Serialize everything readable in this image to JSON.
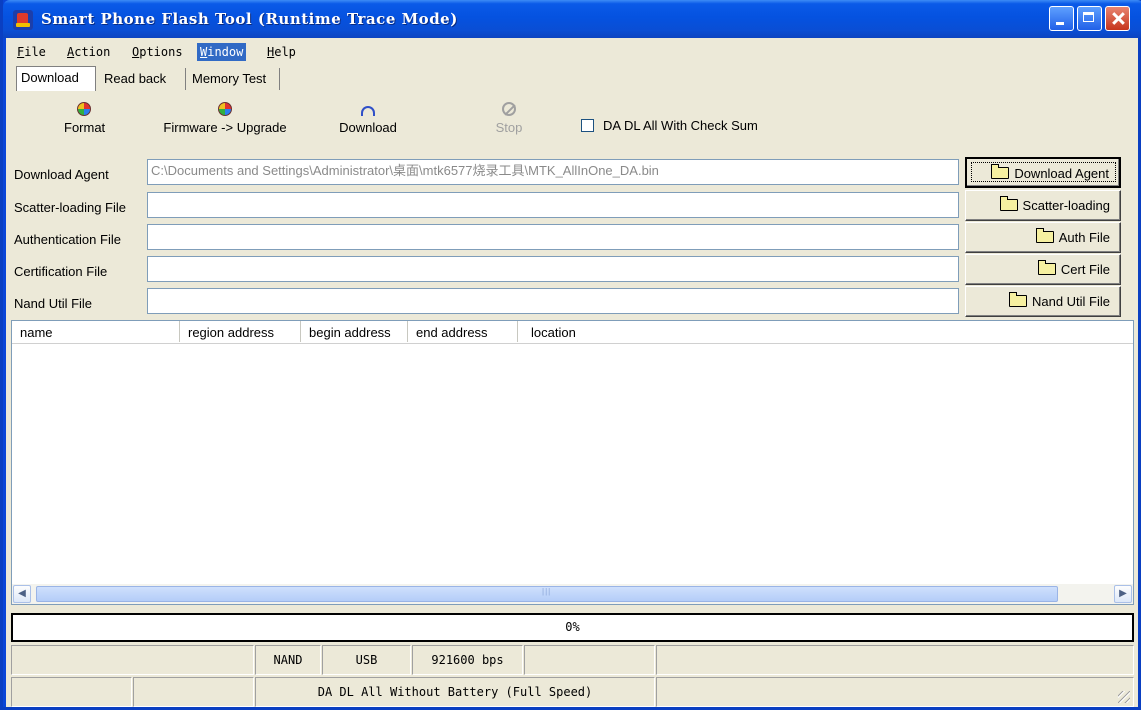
{
  "window": {
    "title": "Smart Phone Flash Tool (Runtime Trace Mode)"
  },
  "menu": [
    "File",
    "Action",
    "Options",
    "Window",
    "Help"
  ],
  "menu_accel": [
    "F",
    "A",
    "O",
    "W",
    "H"
  ],
  "tabs": [
    "Download",
    "Read back",
    "Memory Test"
  ],
  "toolbar": {
    "format": "Format",
    "firmware_upgrade": "Firmware -> Upgrade",
    "download": "Download",
    "stop": "Stop",
    "checksum_label": "DA DL All With Check Sum"
  },
  "fields": [
    {
      "label": "Download Agent",
      "value": "C:\\Documents and Settings\\Administrator\\桌面\\mtk6577烧录工具\\MTK_AllInOne_DA.bin",
      "button": "Download Agent"
    },
    {
      "label": "Scatter-loading File",
      "value": "",
      "button": "Scatter-loading"
    },
    {
      "label": "Authentication File",
      "value": "",
      "button": "Auth File"
    },
    {
      "label": "Certification File",
      "value": "",
      "button": "Cert File"
    },
    {
      "label": "Nand Util File",
      "value": "",
      "button": "Nand Util File"
    }
  ],
  "list": {
    "columns": [
      "name",
      "region address",
      "begin address",
      "end address",
      "location"
    ]
  },
  "progress": {
    "value": 0,
    "text": "0%"
  },
  "status": {
    "storage": "NAND",
    "port": "USB",
    "baud": "921600 bps",
    "mode": "DA DL All Without Battery (Full Speed)"
  },
  "colors": {
    "titlebar": "#0a5ae8",
    "menu_highlight": "#316ac5",
    "face": "#ece9d8"
  }
}
